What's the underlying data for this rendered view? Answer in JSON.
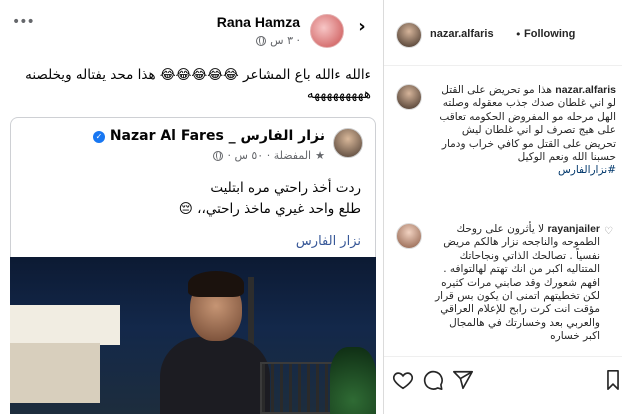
{
  "facebook_post": {
    "author": "Rana Hamza",
    "time": "٣ س ·",
    "text": "ءالله ءالله باع المشاعر 😂😂😂😂😂 هذا محد يفتاله ويخلصنه هههههههههه",
    "shared_post": {
      "author": "نزار الفارس _ Nazar Al Fares",
      "meta": "المفضلة · ٥٠ س ·",
      "line1": "ردت أخذ راحتي مره ابتليت",
      "line2": "طلع واحد غيري ماخذ راحتي،، 😔",
      "signature": "نزار الفارس"
    }
  },
  "instagram": {
    "header": {
      "username": "nazar.alfaris",
      "separator": "•",
      "follow_status": "Following"
    },
    "caption": {
      "username": "nazar.alfaris",
      "text": "هذا مو تحريض على القتل لو اني غلطان صدك جذب معقوله وصلته الهل مرحله مو المفروض الحكومه تعاقب على هيج تصرف لو اني غلطان ليش تحريض على القتل مو كافي خراب ودمار حسبنا الله ونعم الوكيل",
      "hashtag": "#نزارالفارس"
    },
    "comment": {
      "username": "rayanjailer",
      "text": "لا يأثرون على روحك الطموحه والناجحه نزار هالكم مريض نفسياً . تصالحك الذاتي ونجاحاتك المتتاليه اكبر من انك تهتم لهالتوافه . افهم شعورك وقد صابني مرات كثيره لكن تخطيتهم اتمنى ان يكون بس قرار مؤقت انت كرت رابح للإعلام العراقي والعربي بعد وخسارتك في هالمجال اكبر خساره"
    }
  }
}
